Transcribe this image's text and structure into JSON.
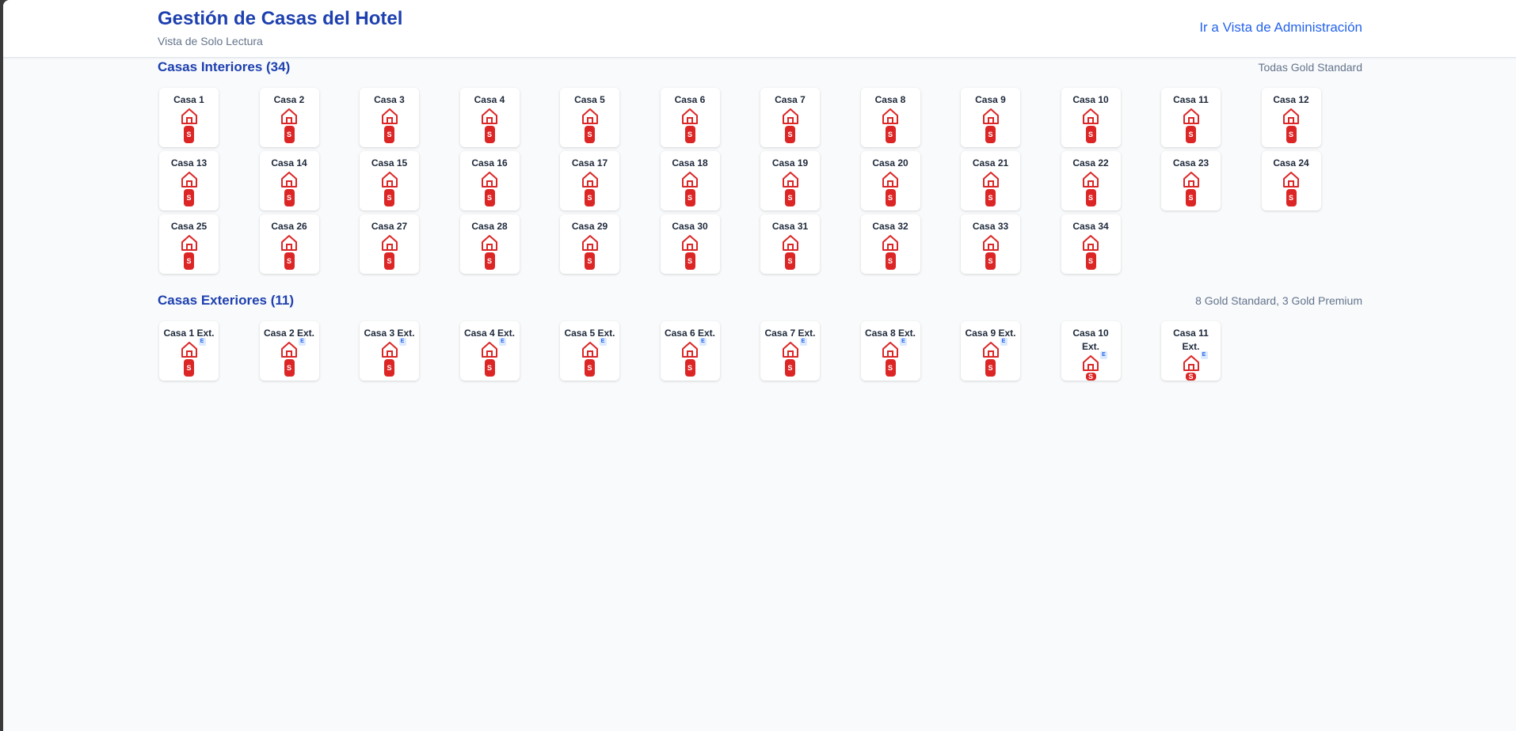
{
  "header": {
    "title": "Gestión de Casas del Hotel",
    "subtitle": "Vista de Solo Lectura",
    "admin_link": "Ir a Vista de Administración"
  },
  "interior": {
    "title": "Casas Interiores (34)",
    "meta": "Todas Gold Standard",
    "houses": [
      "Casa 1",
      "Casa 2",
      "Casa 3",
      "Casa 4",
      "Casa 5",
      "Casa 6",
      "Casa 7",
      "Casa 8",
      "Casa 9",
      "Casa 10",
      "Casa 11",
      "Casa 12",
      "Casa 13",
      "Casa 14",
      "Casa 15",
      "Casa 16",
      "Casa 17",
      "Casa 18",
      "Casa 19",
      "Casa 20",
      "Casa 21",
      "Casa 22",
      "Casa 23",
      "Casa 24",
      "Casa 25",
      "Casa 26",
      "Casa 27",
      "Casa 28",
      "Casa 29",
      "Casa 30",
      "Casa 31",
      "Casa 32",
      "Casa 33",
      "Casa 34"
    ],
    "badge": "S"
  },
  "exterior": {
    "title": "Casas Exteriores (11)",
    "meta": "8 Gold Standard, 3 Gold Premium",
    "houses": [
      "Casa 1 Ext.",
      "Casa 2 Ext.",
      "Casa 3 Ext.",
      "Casa 4 Ext.",
      "Casa 5 Ext.",
      "Casa 6 Ext.",
      "Casa 7 Ext.",
      "Casa 8 Ext.",
      "Casa 9 Ext.",
      "Casa 10 Ext.",
      "Casa 11 Ext."
    ],
    "badge": "S",
    "ext_marker": "E"
  },
  "colors": {
    "title_blue": "#1e40af",
    "link_blue": "#2563eb",
    "status_red": "#dc2626"
  },
  "icons": {
    "house": "house-icon"
  }
}
